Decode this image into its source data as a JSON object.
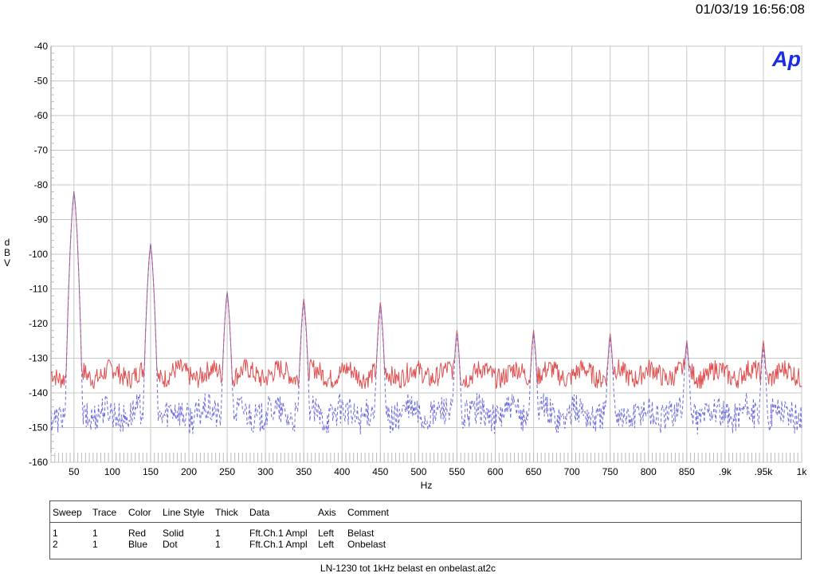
{
  "header": {
    "timestamp": "01/03/19 16:56:08",
    "logo_text": "Ap"
  },
  "chart_data": {
    "type": "line",
    "ylabel": "dBV",
    "xlabel": "Hz",
    "xlim": [
      20,
      1000
    ],
    "ylim": [
      -160,
      -40
    ],
    "y_ticks": [
      -40,
      -50,
      -60,
      -70,
      -80,
      -90,
      -100,
      -110,
      -120,
      -130,
      -140,
      -150,
      -160
    ],
    "x_ticks": [
      {
        "v": 50,
        "label": "50"
      },
      {
        "v": 100,
        "label": "100"
      },
      {
        "v": 150,
        "label": "150"
      },
      {
        "v": 200,
        "label": "200"
      },
      {
        "v": 250,
        "label": "250"
      },
      {
        "v": 300,
        "label": "300"
      },
      {
        "v": 350,
        "label": "350"
      },
      {
        "v": 400,
        "label": "400"
      },
      {
        "v": 450,
        "label": "450"
      },
      {
        "v": 500,
        "label": "500"
      },
      {
        "v": 550,
        "label": "550"
      },
      {
        "v": 600,
        "label": "600"
      },
      {
        "v": 650,
        "label": "650"
      },
      {
        "v": 700,
        "label": "700"
      },
      {
        "v": 750,
        "label": "750"
      },
      {
        "v": 800,
        "label": "800"
      },
      {
        "v": 850,
        "label": "850"
      },
      {
        "v": 900,
        "label": ".9k"
      },
      {
        "v": 950,
        "label": ".95k"
      },
      {
        "v": 1000,
        "label": "1k"
      }
    ],
    "grid": true,
    "series": [
      {
        "name": "Belast",
        "color": "#e05050",
        "style": "solid",
        "floor": -134.5,
        "peaks": [
          {
            "x": 50,
            "y": -82
          },
          {
            "x": 150,
            "y": -97
          },
          {
            "x": 250,
            "y": -111
          },
          {
            "x": 350,
            "y": -113
          },
          {
            "x": 450,
            "y": -114
          },
          {
            "x": 550,
            "y": -122
          },
          {
            "x": 650,
            "y": -122
          },
          {
            "x": 750,
            "y": -123
          },
          {
            "x": 850,
            "y": -125
          },
          {
            "x": 950,
            "y": -125
          }
        ]
      },
      {
        "name": "Onbelast",
        "color": "#6a6ae0",
        "style": "dash",
        "floor": -146,
        "peaks": [
          {
            "x": 50,
            "y": -82
          },
          {
            "x": 150,
            "y": -97
          },
          {
            "x": 250,
            "y": -111
          },
          {
            "x": 350,
            "y": -114
          },
          {
            "x": 450,
            "y": -115
          },
          {
            "x": 550,
            "y": -123
          },
          {
            "x": 650,
            "y": -123
          },
          {
            "x": 750,
            "y": -124
          },
          {
            "x": 850,
            "y": -126
          },
          {
            "x": 950,
            "y": -127
          }
        ]
      }
    ]
  },
  "legend": {
    "headers": [
      "Sweep",
      "Trace",
      "Color",
      "Line Style",
      "Thick",
      "Data",
      "Axis",
      "Comment"
    ],
    "rows": [
      [
        "1",
        "1",
        "Red",
        "Solid",
        "1",
        "Fft.Ch.1 Ampl",
        "Left",
        "Belast"
      ],
      [
        "2",
        "1",
        "Blue",
        "Dot",
        "1",
        "Fft.Ch.1 Ampl",
        "Left",
        "Onbelast"
      ]
    ]
  },
  "footer": {
    "title": "LN-1230 tot 1kHz belast en onbelast.at2c"
  }
}
